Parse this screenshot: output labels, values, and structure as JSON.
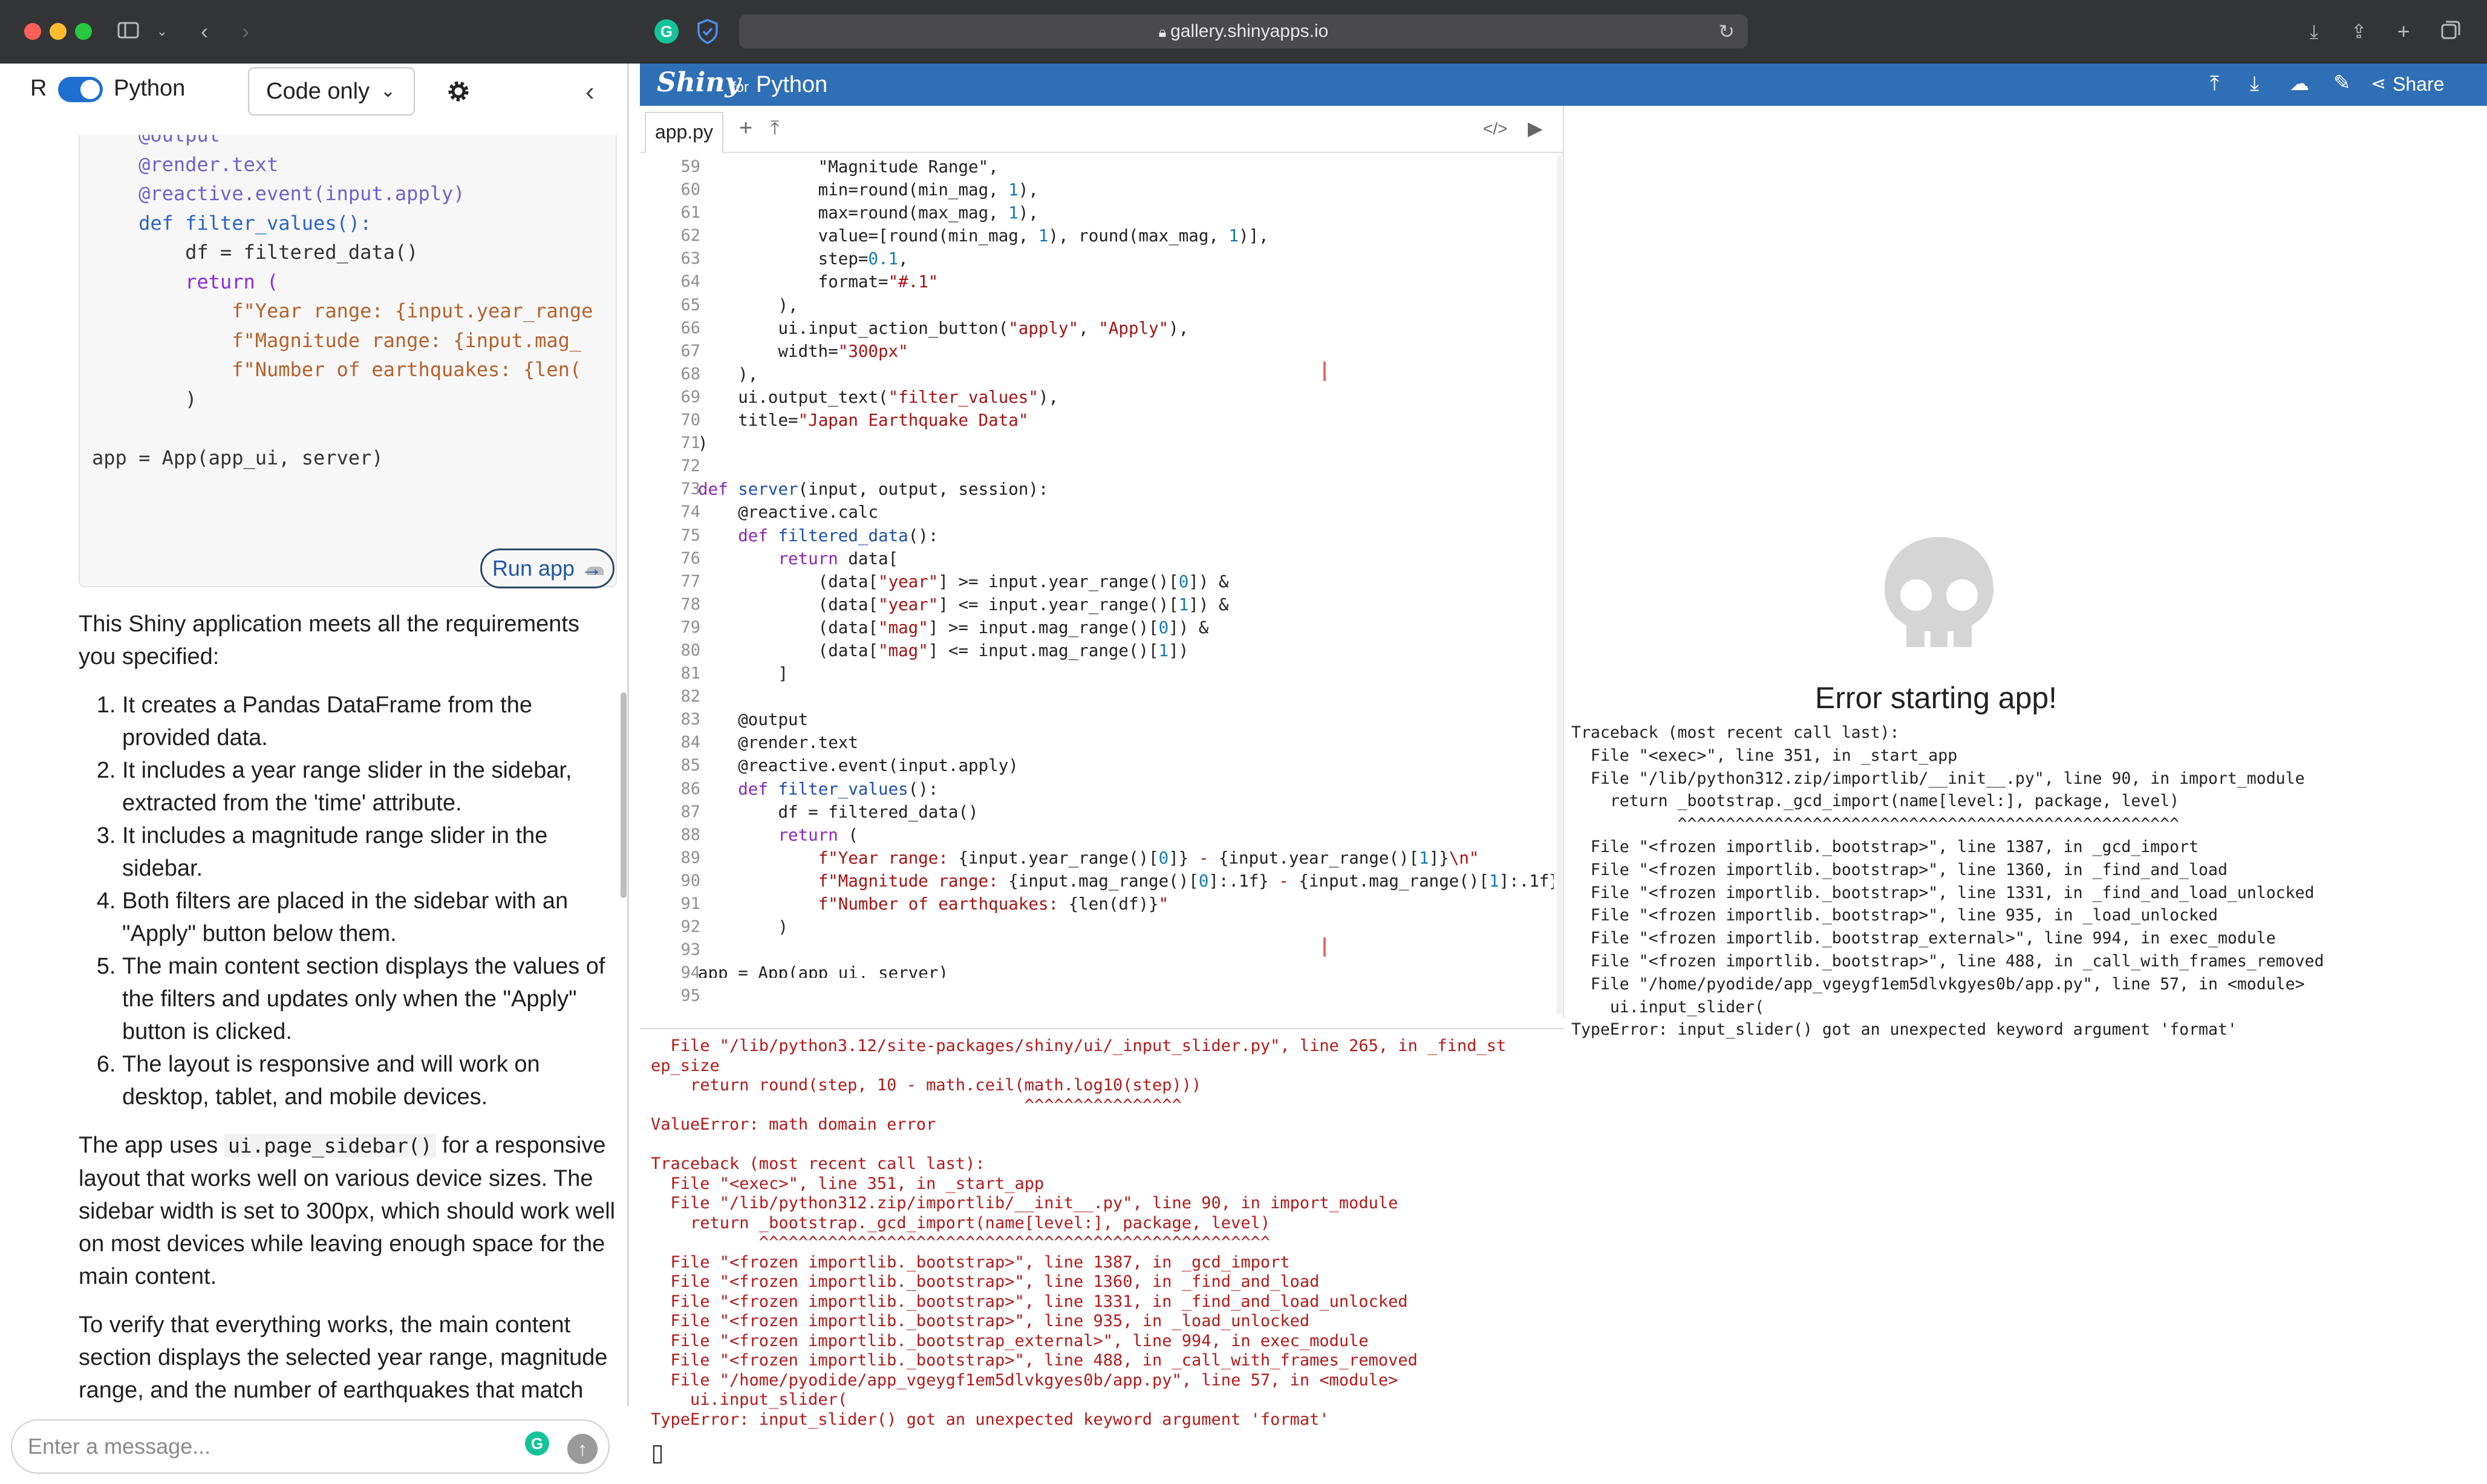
{
  "browser": {
    "url": "gallery.shinyapps.io"
  },
  "left_panel": {
    "r_label": "R",
    "python_label": "Python",
    "mode_select": "Code only",
    "code_lines": [
      "    @output",
      "    @render.text",
      "    @reactive.event(input.apply)",
      "    def filter_values():",
      "        df = filtered_data()",
      "        return (",
      "            f\"Year range: {input.year_range",
      "            f\"Magnitude range: {input.mag_",
      "            f\"Number of earthquakes: {len(",
      "        )",
      "",
      "app = App(app_ui, server)"
    ],
    "run_app": "Run app →",
    "intro": "This Shiny application meets all the requirements you specified:",
    "list": [
      "It creates a Pandas DataFrame from the provided data.",
      "It includes a year range slider in the sidebar, extracted from the 'time' attribute.",
      "It includes a magnitude range slider in the sidebar.",
      "Both filters are placed in the sidebar with an \"Apply\" button below them.",
      "The main content section displays the values of the filters and updates only when the \"Apply\" button is clicked.",
      "The layout is responsive and will work on desktop, tablet, and mobile devices."
    ],
    "para2_a": "The app uses ",
    "para2_code": "ui.page_sidebar()",
    "para2_b": " for a responsive layout that works well on various device sizes. The sidebar width is set to 300px, which should work well on most devices while leaving enough space for the main content.",
    "para3": "To verify that everything works, the main content section displays the selected year range, magnitude range, and the number of earthquakes that match",
    "message_placeholder": "Enter a message..."
  },
  "shiny_header": {
    "brand": "Shiny",
    "brand_for": "for",
    "brand_python": "Python",
    "share": "Share"
  },
  "editor": {
    "tab": "app.py",
    "line_numbers": [
      "59",
      "60",
      "61",
      "62",
      "63",
      "64",
      "65",
      "66",
      "67",
      "68",
      "69",
      "70",
      "71",
      "72",
      "73",
      "74",
      "75",
      "76",
      "77",
      "78",
      "79",
      "80",
      "81",
      "82",
      "83",
      "84",
      "85",
      "86",
      "87",
      "88",
      "89",
      "90",
      "91",
      "92",
      "93",
      "94",
      "95"
    ]
  },
  "console_text": "  File \"/lib/python3.12/site-packages/shiny/ui/_input_slider.py\", line 265, in _find_st\nep_size\n    return round(step, 10 - math.ceil(math.log10(step)))\n                                      ^^^^^^^^^^^^^^^^\nValueError: math domain error\n\nTraceback (most recent call last):\n  File \"<exec>\", line 351, in _start_app\n  File \"/lib/python312.zip/importlib/__init__.py\", line 90, in import_module\n    return _bootstrap._gcd_import(name[level:], package, level)\n           ^^^^^^^^^^^^^^^^^^^^^^^^^^^^^^^^^^^^^^^^^^^^^^^^^^^^\n  File \"<frozen importlib._bootstrap>\", line 1387, in _gcd_import\n  File \"<frozen importlib._bootstrap>\", line 1360, in _find_and_load\n  File \"<frozen importlib._bootstrap>\", line 1331, in _find_and_load_unlocked\n  File \"<frozen importlib._bootstrap>\", line 935, in _load_unlocked\n  File \"<frozen importlib._bootstrap_external>\", line 994, in exec_module\n  File \"<frozen importlib._bootstrap>\", line 488, in _call_with_frames_removed\n  File \"/home/pyodide/app_vgeygf1em5dlvkgyes0b/app.py\", line 57, in <module>\n    ui.input_slider(\nTypeError: input_slider() got an unexpected keyword argument 'format'",
  "preview": {
    "error_title": "Error starting app!",
    "traceback": "Traceback (most recent call last):\n  File \"<exec>\", line 351, in _start_app\n  File \"/lib/python312.zip/importlib/__init__.py\", line 90, in import_module\n    return _bootstrap._gcd_import(name[level:], package, level)\n           ^^^^^^^^^^^^^^^^^^^^^^^^^^^^^^^^^^^^^^^^^^^^^^^^^^^^\n  File \"<frozen importlib._bootstrap>\", line 1387, in _gcd_import\n  File \"<frozen importlib._bootstrap>\", line 1360, in _find_and_load\n  File \"<frozen importlib._bootstrap>\", line 1331, in _find_and_load_unlocked\n  File \"<frozen importlib._bootstrap>\", line 935, in _load_unlocked\n  File \"<frozen importlib._bootstrap_external>\", line 994, in exec_module\n  File \"<frozen importlib._bootstrap>\", line 488, in _call_with_frames_removed\n  File \"/home/pyodide/app_vgeygf1em5dlvkgyes0b/app.py\", line 57, in <module>\n    ui.input_slider(\nTypeError: input_slider() got an unexpected keyword argument 'format'"
  }
}
